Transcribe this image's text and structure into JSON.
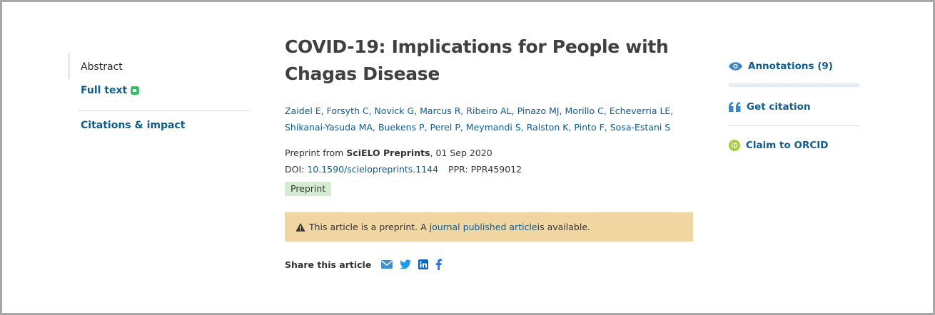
{
  "left_nav": {
    "abstract": "Abstract",
    "full_text": "Full text",
    "citations": "Citations & impact"
  },
  "article": {
    "title": "COVID-19: Implications for People with Chagas Disease",
    "authors": [
      "Zaidel E",
      "Forsyth C",
      "Novick G",
      "Marcus R",
      "Ribeiro AL",
      "Pinazo MJ",
      "Morillo C",
      "Echeverria LE",
      "Shikanai-Yasuda MA",
      "Buekens P",
      "Perel P",
      "Meymandi S",
      "Ralston K",
      "Pinto F",
      "Sosa-Estani S"
    ],
    "source_prefix": "Preprint from ",
    "source": "SciELO Preprints",
    "date": ", 01 Sep 2020",
    "doi_label": "DOI: ",
    "doi": "10.1590/scielopreprints.1144",
    "ppr": "PPR: PPR459012",
    "badge": "Preprint"
  },
  "notice": {
    "prefix": "This article is a preprint. A ",
    "link": "journal published article",
    "suffix": " is available."
  },
  "share": {
    "label": "Share this article",
    "icons": [
      "email-icon",
      "twitter-icon",
      "linkedin-icon",
      "facebook-icon"
    ]
  },
  "right_bar": {
    "annotations": "Annotations (9)",
    "get_citation": "Get citation",
    "claim_orcid": "Claim to ORCID"
  },
  "colors": {
    "link": "#0f5c8e",
    "notice_bg": "#f2d6a2",
    "badge_bg": "#d6ecd2",
    "orcid": "#a6ce39",
    "open_access": "#35c16c"
  }
}
